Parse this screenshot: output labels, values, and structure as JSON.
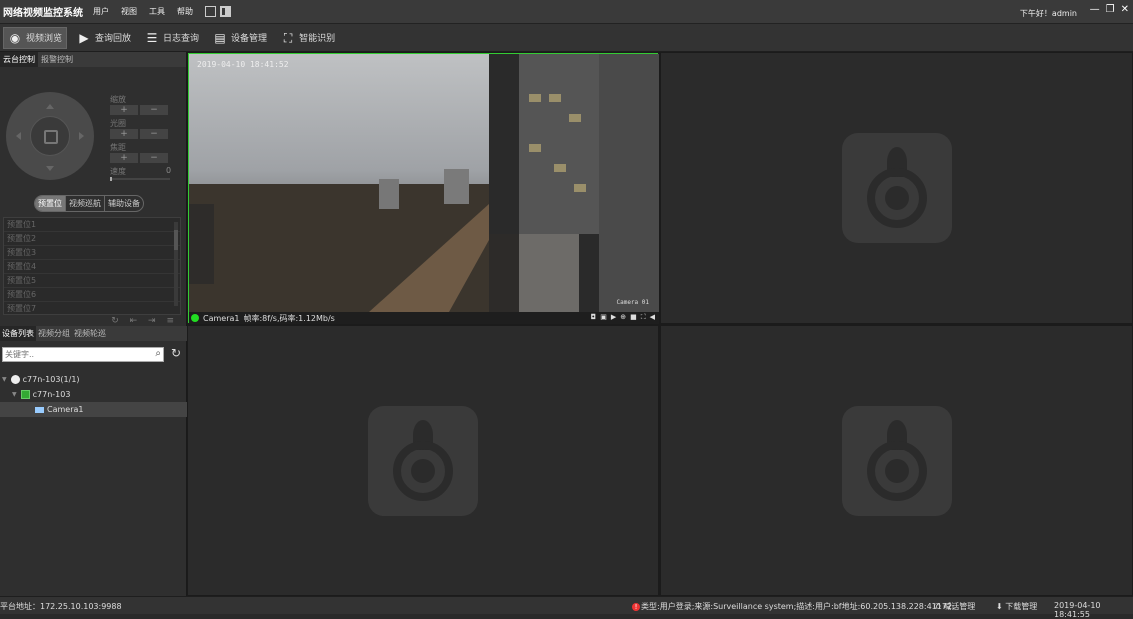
{
  "menubar": {
    "title": "网络视频监控系统",
    "menus": [
      "用户",
      "视图",
      "工具",
      "帮助"
    ],
    "greeting": "下午好！admin",
    "window_buttons": [
      "—",
      "❐",
      "✕"
    ]
  },
  "toolbar": {
    "buttons": [
      {
        "label": "视频浏览",
        "icon": "camera-icon",
        "active": true
      },
      {
        "label": "查询回放",
        "icon": "play-icon",
        "active": false
      },
      {
        "label": "日志查询",
        "icon": "log-icon",
        "active": false
      },
      {
        "label": "设备管理",
        "icon": "device-icon",
        "active": false
      },
      {
        "label": "智能识别",
        "icon": "face-recognition-icon",
        "active": false
      }
    ]
  },
  "left_panel": {
    "tabs": [
      "云台控制",
      "报警控制"
    ],
    "controls": {
      "zoom": "缩放",
      "iris": "光圈",
      "focus": "焦距",
      "speed": "速度",
      "speed_value": "0"
    },
    "segments": [
      "预置位",
      "视频巡航",
      "辅助设备"
    ],
    "presets": [
      "预置位1",
      "预置位2",
      "预置位3",
      "预置位4",
      "预置位5",
      "预置位6",
      "预置位7"
    ],
    "preset_tools": "↻ ⇤ ⇥ ≡",
    "device_tabs": [
      "设备列表",
      "视频分组",
      "视频轮巡"
    ],
    "search_placeholder": "关键字..",
    "tree": [
      {
        "label": "c77n-103(1/1)",
        "type": "server",
        "indent": 0
      },
      {
        "label": "c77n-103",
        "type": "nvr",
        "indent": 1
      },
      {
        "label": "Camera1",
        "type": "camera",
        "indent": 2,
        "selected": true
      }
    ]
  },
  "video": {
    "osd_time": "2019-04-10 18:41:52",
    "osd_cam": "Camera 01",
    "camera_name": "Camera1",
    "stats": "帧率:8f/s,码率:1.12Mb/s"
  },
  "statusbar": {
    "address": "平台地址：172.25.10.103:9988",
    "alert": "类型:用户登录;来源:Surveillance system;描述:用户:bf地址:60.205.138.228:41172;",
    "talk": "喊话管理",
    "download": "下载管理",
    "datetime": "2019-04-10 18:41:55"
  }
}
